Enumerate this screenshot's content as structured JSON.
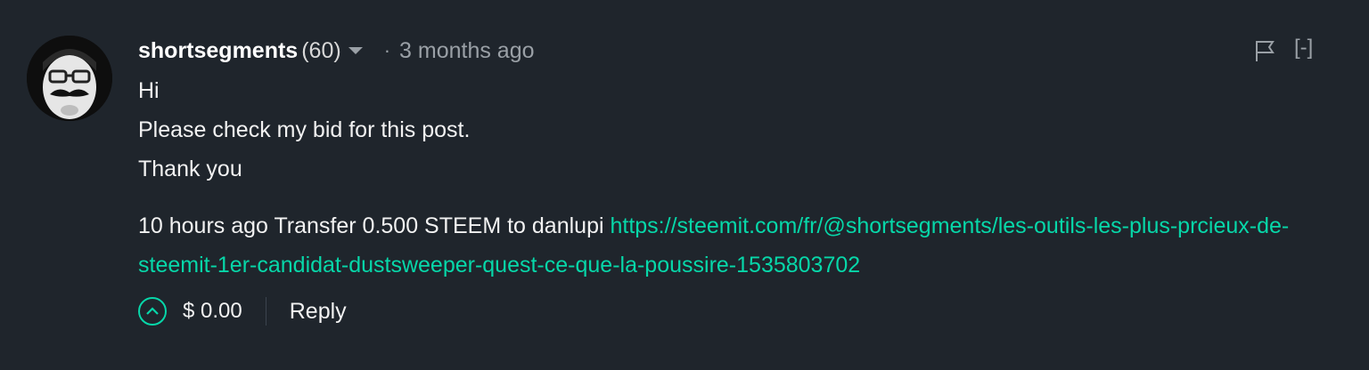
{
  "comment": {
    "author": "shortsegments",
    "reputation": "(60)",
    "separator_dot": "·",
    "timestamp": "3 months ago",
    "collapse_label": "[-]",
    "body": {
      "line1": "Hi",
      "line2": "Please check my bid for this post.",
      "line3": "Thank you",
      "transfer_text": "10 hours ago Transfer 0.500 STEEM to danlupi ",
      "link_text": "https://steemit.com/fr/@shortsegments/les-outils-les-plus-prcieux-de-steemit-1er-candidat-dustsweeper-quest-ce-que-la-poussire-1535803702"
    },
    "footer": {
      "payout": "$ 0.00",
      "reply_label": "Reply"
    }
  },
  "icons": {
    "avatar": "avatar",
    "dropdown": "chevron-down-icon",
    "flag": "flag-icon",
    "upvote": "upvote-icon"
  },
  "colors": {
    "background": "#1f252c",
    "accent": "#07d7a9",
    "muted": "#9aa0a6",
    "text": "#f2f2f2"
  }
}
